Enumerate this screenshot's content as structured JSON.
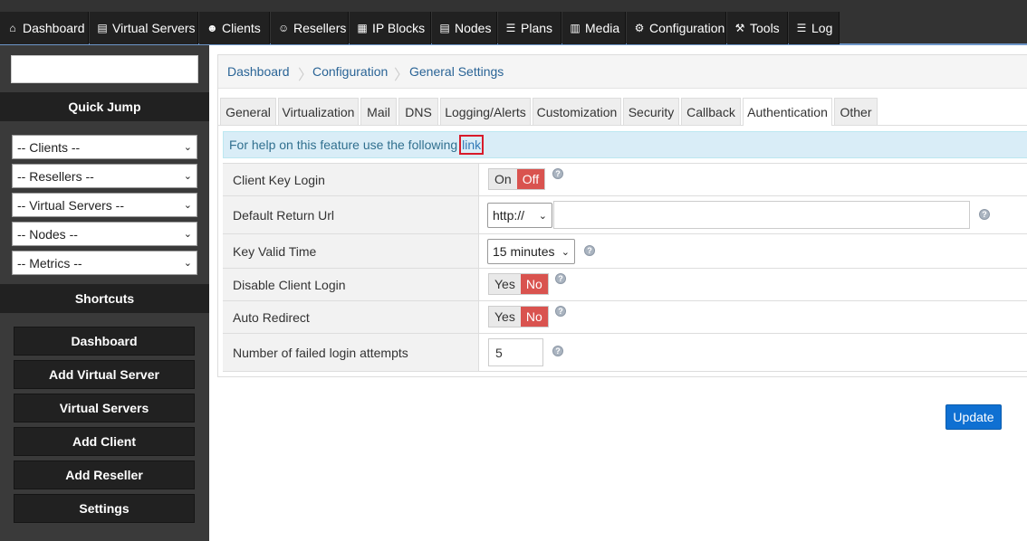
{
  "topnav": [
    {
      "label": "Dashboard",
      "icon": "home-icon",
      "glyph": "⌂"
    },
    {
      "label": "Virtual Servers",
      "icon": "server-icon",
      "glyph": "▤"
    },
    {
      "label": "Clients",
      "icon": "users-icon",
      "glyph": "☻"
    },
    {
      "label": "Resellers",
      "icon": "user-icon",
      "glyph": "☺"
    },
    {
      "label": "IP Blocks",
      "icon": "grid-icon",
      "glyph": "▦"
    },
    {
      "label": "Nodes",
      "icon": "server-stack-icon",
      "glyph": "▤"
    },
    {
      "label": "Plans",
      "icon": "list-icon",
      "glyph": "☰"
    },
    {
      "label": "Media",
      "icon": "file-icon",
      "glyph": "▥"
    },
    {
      "label": "Configuration",
      "icon": "gear-icon",
      "glyph": "⚙"
    },
    {
      "label": "Tools",
      "icon": "wrench-icon",
      "glyph": "⚒"
    },
    {
      "label": "Log",
      "icon": "list-lines-icon",
      "glyph": "☰"
    }
  ],
  "sidebar": {
    "search_value": "",
    "quick_jump_title": "Quick Jump",
    "jumps": [
      "-- Clients --",
      "-- Resellers --",
      "-- Virtual Servers --",
      "-- Nodes --",
      "-- Metrics --"
    ],
    "shortcuts_title": "Shortcuts",
    "shortcuts": [
      "Dashboard",
      "Add Virtual Server",
      "Virtual Servers",
      "Add Client",
      "Add Reseller",
      "Settings"
    ]
  },
  "breadcrumb": [
    "Dashboard",
    "Configuration",
    "General Settings"
  ],
  "tabs": [
    "General",
    "Virtualization",
    "Mail",
    "DNS",
    "Logging/Alerts",
    "Customization",
    "Security",
    "Callback",
    "Authentication",
    "Other"
  ],
  "active_tab": "Authentication",
  "help": {
    "text": "For help on this feature use the following ",
    "link": "link"
  },
  "settings": {
    "client_key_login": {
      "label": "Client Key Login",
      "on": "On",
      "off": "Off",
      "selected": "Off"
    },
    "default_return_url": {
      "label": "Default Return Url",
      "protocol": "http://",
      "value": ""
    },
    "key_valid_time": {
      "label": "Key Valid Time",
      "value": "15 minutes"
    },
    "disable_client_login": {
      "label": "Disable Client Login",
      "yes": "Yes",
      "no": "No",
      "selected": "No"
    },
    "auto_redirect": {
      "label": "Auto Redirect",
      "yes": "Yes",
      "no": "No",
      "selected": "No"
    },
    "failed_login_attempts": {
      "label": "Number of failed login attempts",
      "value": "5"
    }
  },
  "help_icon_glyph": "?",
  "chevron_glyph": "⌄",
  "update_label": "Update",
  "colors": {
    "accent_blue": "#0f70d2",
    "toggle_selected": "#d9534f",
    "nav_dark": "#212121",
    "help_bg": "#d9edf7"
  }
}
